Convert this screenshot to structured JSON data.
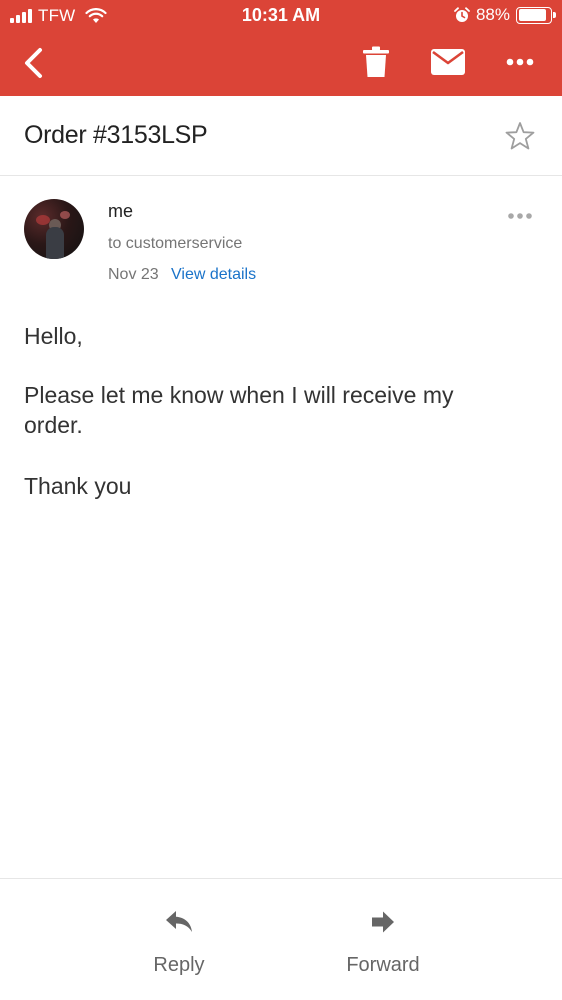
{
  "status_bar": {
    "carrier": "TFW",
    "time": "10:31 AM",
    "battery_percent": "88%",
    "battery_level": 0.88,
    "signal_icon": "signal-bars-icon",
    "wifi_icon": "wifi-icon",
    "alarm_icon": "alarm-clock-icon"
  },
  "app_bar": {
    "color": "#db4437",
    "back_icon": "chevron-left-icon",
    "actions": [
      "trash-icon",
      "mail-icon",
      "more-horizontal-icon"
    ]
  },
  "email": {
    "subject": "Order #3153LSP",
    "starred": false,
    "sender": "me",
    "recipient": "to customerservice",
    "date": "Nov 23",
    "view_details": "View details",
    "body": {
      "greeting": "Hello,",
      "paragraph": "Please let me know when I will receive my order.",
      "signoff": "Thank you"
    }
  },
  "bottom_actions": {
    "reply": "Reply",
    "forward": "Forward"
  }
}
